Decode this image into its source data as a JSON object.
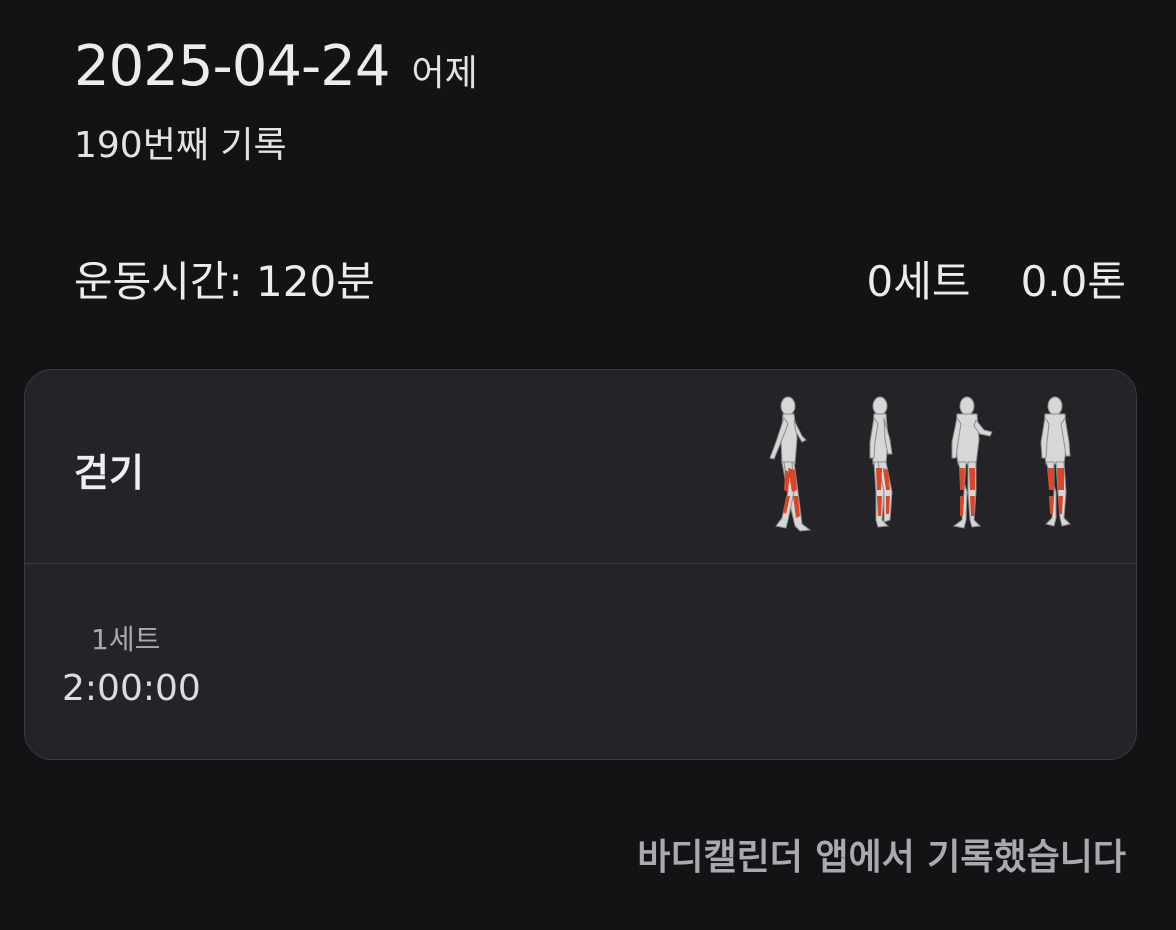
{
  "header": {
    "date": "2025-04-24",
    "relative_day": "어제",
    "record_count": "190번째 기록"
  },
  "stats": {
    "duration": "운동시간: 120분",
    "sets": "0세트",
    "volume": "0.0톤"
  },
  "exercise": {
    "name": "걷기",
    "muscle_icons": [
      "walking-figure-side-left-icon",
      "walking-figure-side-right-icon",
      "walking-figure-front-icon",
      "walking-figure-back-icon"
    ],
    "set_label": "1세트",
    "set_time": "2:00:00"
  },
  "colors": {
    "background": "#131316",
    "card": "#232328",
    "muscle_highlight": "#d8472a"
  },
  "footer": {
    "note": "바디캘린더 앱에서 기록했습니다"
  }
}
